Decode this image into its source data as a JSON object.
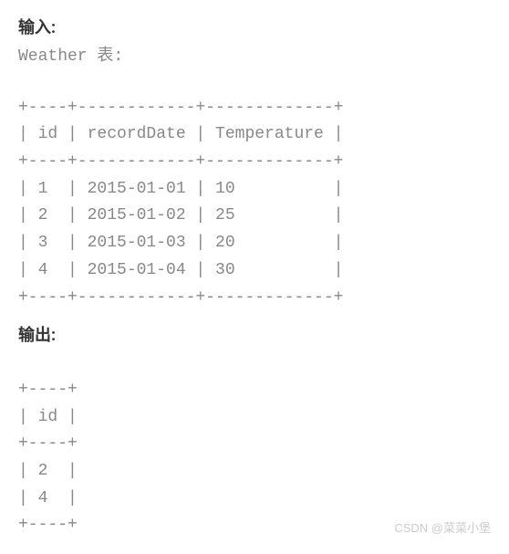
{
  "input": {
    "heading": "输入:",
    "tableLabel": "Weather 表:",
    "border": "+----+------------+-------------+",
    "headerRow": "| id | recordDate | Temperature |",
    "rows": [
      "| 1  | 2015-01-01 | 10          |",
      "| 2  | 2015-01-02 | 25          |",
      "| 3  | 2015-01-03 | 20          |",
      "| 4  | 2015-01-04 | 30          |"
    ]
  },
  "output": {
    "heading": "输出:",
    "border": "+----+",
    "headerRow": "| id |",
    "rows": [
      "| 2  |",
      "| 4  |"
    ]
  },
  "watermark": "CSDN @菜菜小堡",
  "chart_data": [
    {
      "type": "table",
      "title": "Weather",
      "columns": [
        "id",
        "recordDate",
        "Temperature"
      ],
      "rows": [
        [
          1,
          "2015-01-01",
          10
        ],
        [
          2,
          "2015-01-02",
          25
        ],
        [
          3,
          "2015-01-03",
          20
        ],
        [
          4,
          "2015-01-04",
          30
        ]
      ]
    },
    {
      "type": "table",
      "title": "Output",
      "columns": [
        "id"
      ],
      "rows": [
        [
          2
        ],
        [
          4
        ]
      ]
    }
  ]
}
